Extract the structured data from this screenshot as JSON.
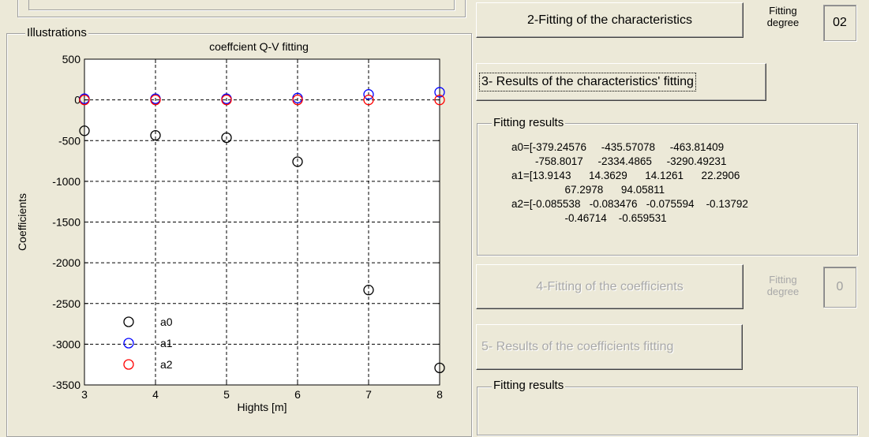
{
  "top_panel": {},
  "illustrations": {
    "frame_title": "Illustrations"
  },
  "chart_data": {
    "type": "scatter",
    "title": "coeffcient Q-V fitting",
    "xlabel": "Hights [m]",
    "ylabel": "Coefficients",
    "xlim": [
      3,
      8
    ],
    "ylim": [
      -3500,
      500
    ],
    "xticks": [
      "3",
      "4",
      "5",
      "6",
      "7",
      "8"
    ],
    "yticks": [
      "500",
      "0",
      "-500",
      "-1000",
      "-1500",
      "-2000",
      "-2500",
      "-3000",
      "-3500"
    ],
    "grid": true,
    "legend_position": "bottom-left",
    "x": [
      3,
      4,
      5,
      6,
      7,
      8
    ],
    "series": [
      {
        "name": "a0",
        "color": "#000000",
        "marker": "circle",
        "values": [
          -379.24576,
          -435.57078,
          -463.81409,
          -758.8017,
          -2334.4865,
          -3290.49231
        ]
      },
      {
        "name": "a1",
        "color": "#0000ff",
        "marker": "circle",
        "values": [
          13.9143,
          14.3629,
          14.1261,
          22.2906,
          67.2978,
          94.05811
        ]
      },
      {
        "name": "a2",
        "color": "#ff0000",
        "marker": "circle",
        "values": [
          -0.085538,
          -0.083476,
          -0.075594,
          -0.13792,
          -0.46714,
          -0.659531
        ]
      }
    ]
  },
  "controls": {
    "btn_fit_characteristics": "2-Fitting of the characteristics",
    "fitting_degree_label_1": "Fitting\ndegree",
    "fitting_degree_value_1": "02",
    "btn_results_characteristics": "3- Results of the characteristics' fitting",
    "fitting_results_title_1": "Fitting results",
    "results_lines": [
      "a0=[-379.24576     -435.57078     -463.81409",
      "        -758.8017     -2334.4865     -3290.49231",
      "a1=[13.9143      14.3629      14.1261      22.2906",
      "                  67.2978      94.05811",
      "a2=[-0.085538   -0.083476   -0.075594    -0.13792",
      "                  -0.46714    -0.659531"
    ],
    "btn_fit_coefficients": "4-Fitting of the coefficients",
    "fitting_degree_label_2": "Fitting\ndegree",
    "fitting_degree_value_2": "0",
    "btn_results_coefficients": "5- Results of the coefficients fitting",
    "fitting_results_title_2": "Fitting results"
  }
}
